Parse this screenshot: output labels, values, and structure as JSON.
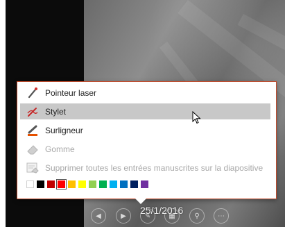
{
  "menu": {
    "items": [
      {
        "label": "Pointeur laser",
        "icon": "laser-pointer-icon",
        "state": "normal"
      },
      {
        "label": "Stylet",
        "icon": "pen-icon",
        "state": "active"
      },
      {
        "label": "Surligneur",
        "icon": "highlighter-icon",
        "state": "normal"
      },
      {
        "label": "Gomme",
        "icon": "eraser-icon",
        "state": "disabled"
      },
      {
        "label": "Supprimer toutes les entrées manuscrites sur la diapositive",
        "icon": "erase-all-icon",
        "state": "disabled"
      }
    ],
    "colors": [
      "#ffffff",
      "#000000",
      "#c00000",
      "#ff0000",
      "#ffc000",
      "#ffff00",
      "#92d050",
      "#00b050",
      "#00b0f0",
      "#0070c0",
      "#002060",
      "#7030a0"
    ],
    "selected_color": "#ff0000",
    "border_color": "#c24b2c"
  },
  "presenter_bar": {
    "date": "25/1/2016",
    "buttons": [
      "previous-icon",
      "next-icon",
      "pen-tool-icon",
      "slides-grid-icon",
      "zoom-icon",
      "more-options-icon"
    ]
  }
}
